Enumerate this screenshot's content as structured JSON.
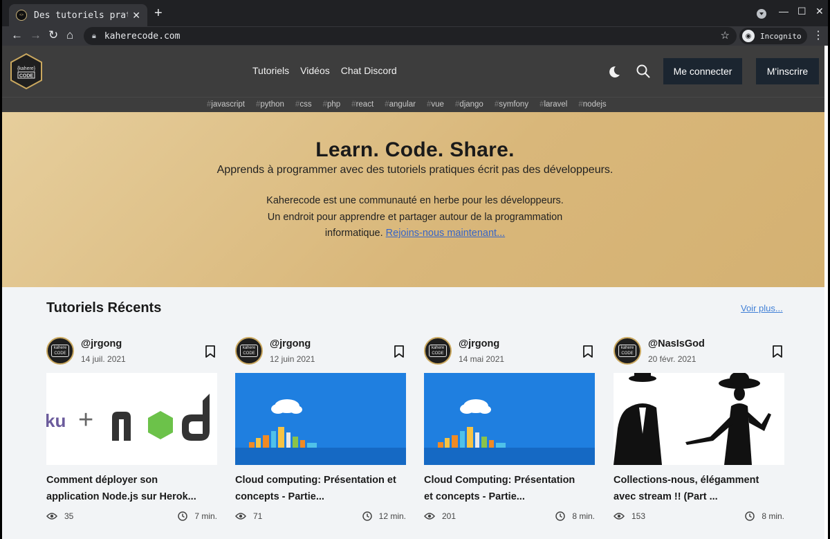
{
  "browser": {
    "tab_title": "Des tutoriels prati",
    "url": "kaherecode.com",
    "incognito_label": "Incognito"
  },
  "site": {
    "logo_text": "{kahere} CODE",
    "nav": [
      "Tutoriels",
      "Vidéos",
      "Chat Discord"
    ],
    "login_label": "Me connecter",
    "signup_label": "M'inscrire",
    "tags": [
      "javascript",
      "python",
      "css",
      "php",
      "react",
      "angular",
      "vue",
      "django",
      "symfony",
      "laravel",
      "nodejs"
    ]
  },
  "hero": {
    "title": "Learn. Code. Share.",
    "subtitle": "Apprends à programmer avec des tutoriels pratiques écrit pas des développeurs.",
    "desc_line1": "Kaherecode est une communauté en herbe pour les développeurs.",
    "desc_line2": "Un endroit pour apprendre et partager autour de la programmation",
    "desc_line3": "informatique.",
    "cta_link": "Rejoins-nous maintenant..."
  },
  "recent": {
    "title": "Tutoriels Récents",
    "see_more": "Voir plus...",
    "cards": [
      {
        "author": "@jrgong",
        "date": "14 juil. 2021",
        "title_l1": "Comment déployer son",
        "title_l2": "application Node.js sur Herok...",
        "views": "35",
        "read_time": "7 min.",
        "thumb": "heroku-node"
      },
      {
        "author": "@jrgong",
        "date": "12 juin 2021",
        "title_l1": "Cloud computing: Présentation et",
        "title_l2": "concepts - Partie...",
        "views": "71",
        "read_time": "12 min.",
        "thumb": "cloud"
      },
      {
        "author": "@jrgong",
        "date": "14 mai 2021",
        "title_l1": "Cloud Computing: Présentation",
        "title_l2": "et concepts - Partie...",
        "views": "201",
        "read_time": "8 min.",
        "thumb": "cloud"
      },
      {
        "author": "@NasIsGod",
        "date": "20 févr. 2021",
        "title_l1": "Collections-nous, élégamment",
        "title_l2": "avec stream !! (Part ...",
        "views": "153",
        "read_time": "8 min.",
        "thumb": "silhouettes"
      }
    ],
    "thumb_texts": {
      "heroku": "ku",
      "plus": "+",
      "node_n": "n",
      "node_d": "d"
    }
  },
  "colors": {
    "header_bg": "#3d3d3d",
    "button_bg": "#1b2530",
    "hero_gold": "#d9b77a",
    "link_blue": "#3f7fd6",
    "logo_gold": "#caa85f"
  }
}
